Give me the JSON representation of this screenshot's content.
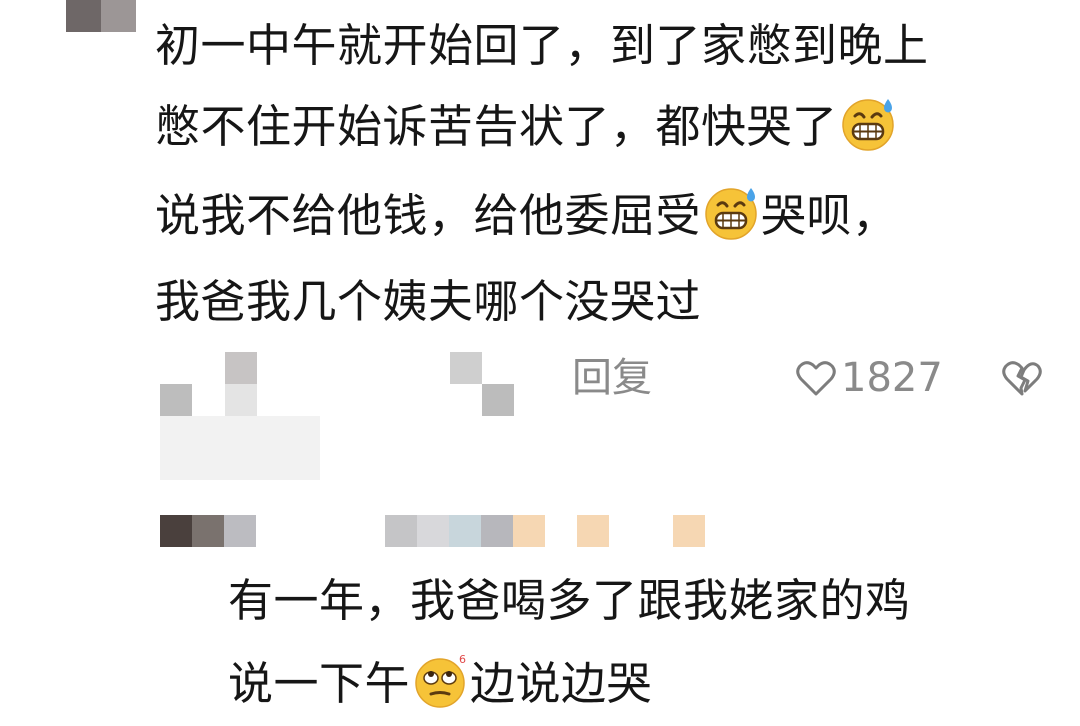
{
  "comment": {
    "lines": [
      {
        "a": "初一中午就开始回了，到了家憋到晚上",
        "b": "",
        "c": ""
      },
      {
        "a": "憋不住开始诉苦告状了，都快哭了",
        "b": "",
        "c": ""
      },
      {
        "a": "说我不给他钱，给他委屈受",
        "b": "哭呗，",
        "c": ""
      },
      {
        "a": "我爸我几个姨夫哪个没哭过",
        "b": "",
        "c": ""
      }
    ],
    "reply_label": "回复",
    "like_count": "1827"
  },
  "reply": {
    "lines": [
      {
        "a": "有一年，我爸喝多了跟我姥家的鸡",
        "b": ""
      },
      {
        "a": "说一下午",
        "b": "边说边哭"
      }
    ]
  },
  "icons": {
    "sweat_emoji": "grinning-sweat-emoji",
    "eyeroll_emoji": "eye-roll-emoji",
    "heart": "heart-outline-icon",
    "broken_heart": "broken-heart-icon"
  }
}
